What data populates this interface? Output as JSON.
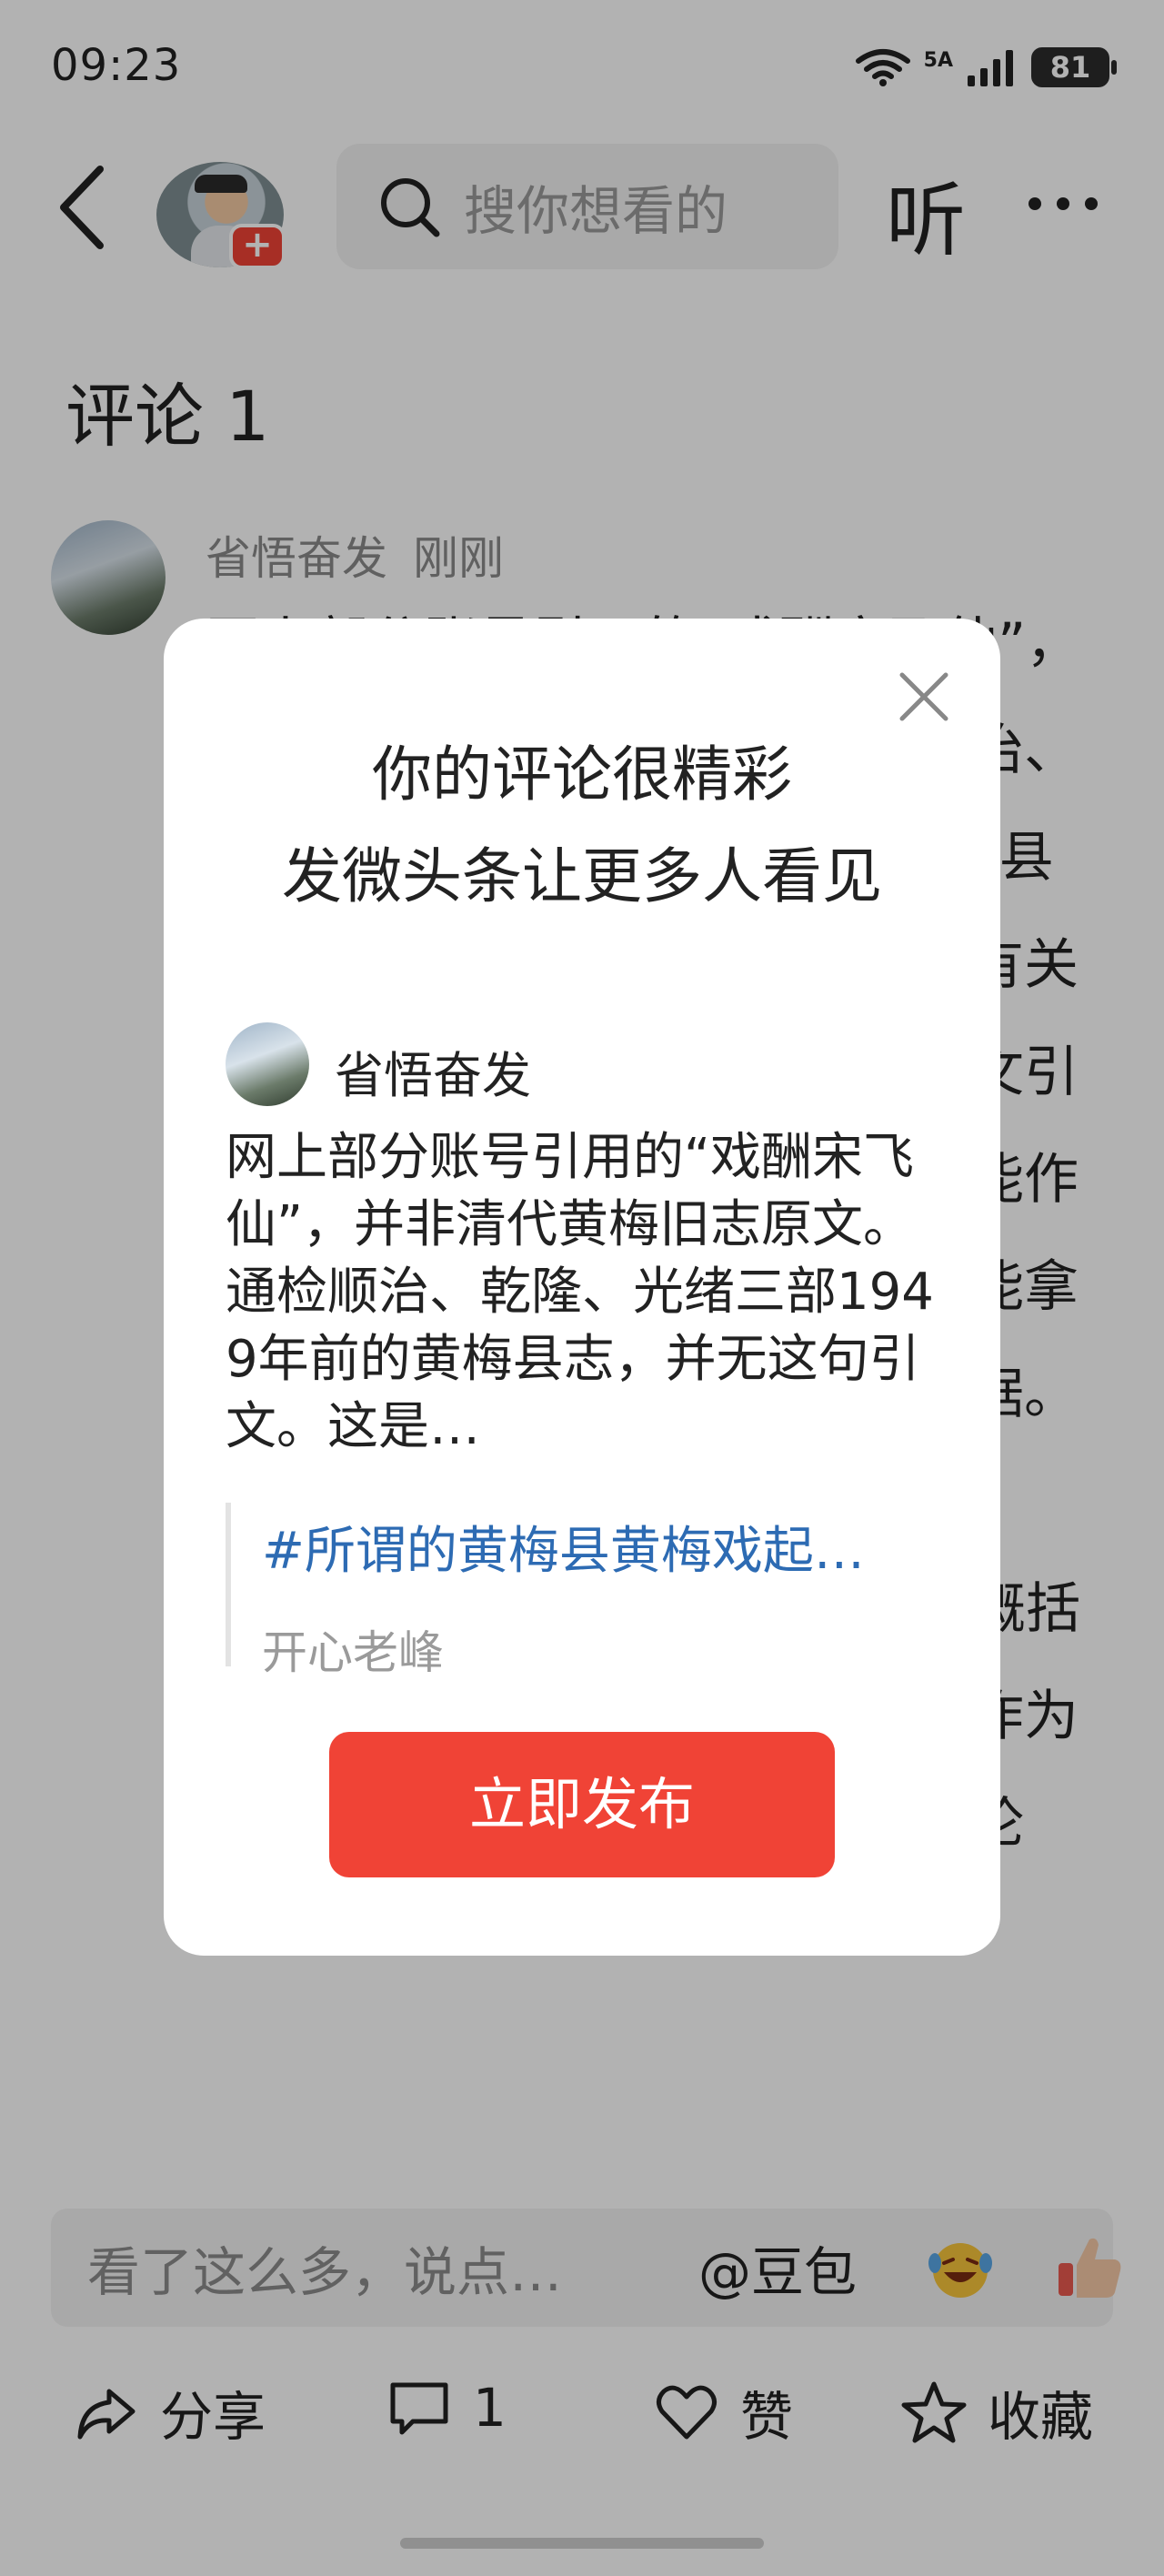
{
  "status_bar": {
    "time": "09:23",
    "network": "5A",
    "battery": "81"
  },
  "nav": {
    "search_placeholder": "搜你想看的",
    "listen_label": "听"
  },
  "comments": {
    "title": "评论 1",
    "item": {
      "user": "省悟奋发",
      "time": "刚刚",
      "text": "网上部分账号引用的“戏酬宋飞仙”，并非清代黄梅旧志原文。通检顺治、乾隆、光绪三部1949年前的黄梅县志，并无这句引文。这是后人将有关地方志史料的资料转述误当作原文引用，以讹传讹，查无实据，更不能作为黄梅戏起源于黄梅县的证据。能拿出清代县志原文的，才能作为考据。\n\n故“戏酬宋飞仙”是后世编撰者的概括语。把后世总结伪装成古籍引文作为核心证据，考据根基不成立，讨论"
    }
  },
  "dialog": {
    "title_line1": "你的评论很精彩",
    "title_line2": "发微头条让更多人看见",
    "preview_user": "省悟奋发",
    "preview_text": "网上部分账号引用的“戏酬宋飞仙”，并非清代黄梅旧志原文。通检顺治、乾隆、光绪三部1949年前的黄梅县志，并无这句引文。这是…",
    "quote_topic": "#所谓的黄梅县黄梅戏起…",
    "quote_author": "开心老峰",
    "publish_label": "立即发布"
  },
  "bottom": {
    "input_placeholder": "看了这么多，说点…",
    "mention": "@豆包",
    "share_label": "分享",
    "comment_count": "1",
    "like_label": "赞",
    "favorite_label": "收藏"
  },
  "colors": {
    "accent_red": "#f04336",
    "link_blue": "#2d6bb3"
  }
}
